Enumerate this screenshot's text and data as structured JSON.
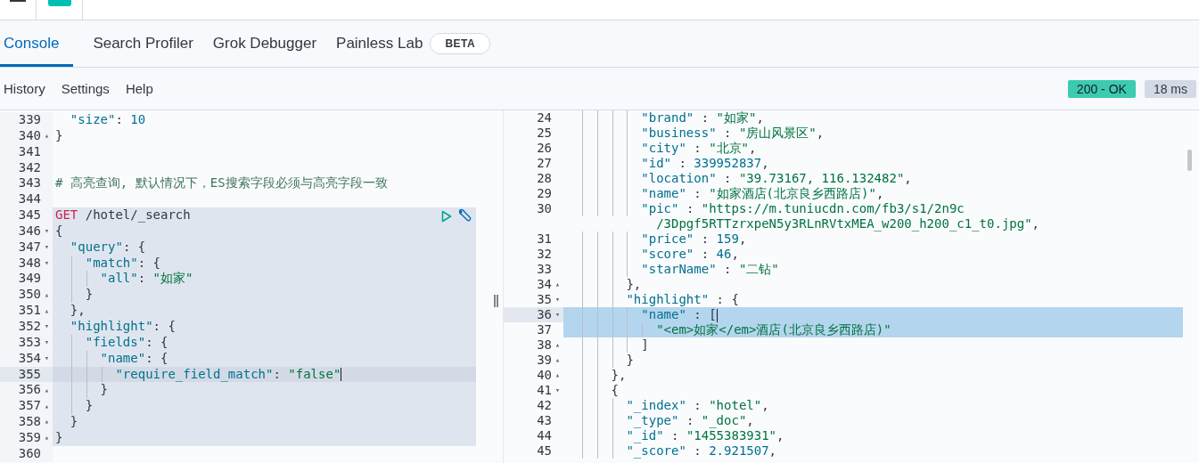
{
  "tabs": [
    {
      "label": "Console",
      "selected": true
    },
    {
      "label": "Search Profiler",
      "selected": false
    },
    {
      "label": "Grok Debugger",
      "selected": false
    },
    {
      "label": "Painless Lab",
      "selected": false,
      "badge": "BETA"
    }
  ],
  "menu": [
    "History",
    "Settings",
    "Help"
  ],
  "status": [
    {
      "text": "200 - OK",
      "kind": "success"
    },
    {
      "text": "18 ms",
      "kind": "neutral"
    }
  ],
  "request_editor": {
    "lines": [
      {
        "number": "339",
        "request": false,
        "active": false,
        "tokens": [
          {
            "kind": "key",
            "text": "  \"size\""
          },
          {
            "kind": "punct",
            "text": ": "
          },
          {
            "kind": "number",
            "text": "10"
          }
        ]
      },
      {
        "number": "340",
        "fold": "▴",
        "request": false,
        "active": false,
        "tokens": [
          {
            "kind": "punct",
            "text": "}"
          }
        ]
      },
      {
        "number": "341",
        "request": false,
        "active": false
      },
      {
        "number": "342",
        "request": false,
        "active": false
      },
      {
        "number": "343",
        "request": false,
        "active": false,
        "tokens": [
          {
            "kind": "comment",
            "text": "# 高亮查询, 默认情况下，ES搜索字段必须与高亮字段一致"
          }
        ]
      },
      {
        "number": "344",
        "request": false,
        "active": false
      },
      {
        "number": "345",
        "request": true,
        "active": false,
        "tokens": [
          {
            "kind": "method",
            "text": "GET"
          },
          {
            "kind": "path",
            "text": " /hotel/_search"
          }
        ]
      },
      {
        "number": "346",
        "fold": "▾",
        "request": true,
        "active": false,
        "tokens": [
          {
            "kind": "punct",
            "text": "{"
          }
        ]
      },
      {
        "number": "347",
        "fold": "▾",
        "request": true,
        "active": false,
        "tokens": [
          {
            "kind": "key",
            "text": "  \"query\""
          },
          {
            "kind": "punct",
            "text": ": {"
          }
        ]
      },
      {
        "number": "348",
        "fold": "▾",
        "request": true,
        "active": false,
        "tokens": [
          {
            "kind": "key",
            "text": "    \"match\""
          },
          {
            "kind": "punct",
            "text": ": {"
          }
        ]
      },
      {
        "number": "349",
        "request": true,
        "active": false,
        "tokens": [
          {
            "kind": "key",
            "text": "      \"all\""
          },
          {
            "kind": "punct",
            "text": ": "
          },
          {
            "kind": "string",
            "text": "\"如家\""
          }
        ]
      },
      {
        "number": "350",
        "fold": "▴",
        "request": true,
        "active": false,
        "tokens": [
          {
            "kind": "punct",
            "text": "    }"
          }
        ]
      },
      {
        "number": "351",
        "fold": "▴",
        "request": true,
        "active": false,
        "tokens": [
          {
            "kind": "punct",
            "text": "  },"
          }
        ]
      },
      {
        "number": "352",
        "fold": "▾",
        "request": true,
        "active": false,
        "tokens": [
          {
            "kind": "key",
            "text": "  \"highlight\""
          },
          {
            "kind": "punct",
            "text": ": {"
          }
        ]
      },
      {
        "number": "353",
        "fold": "▾",
        "request": true,
        "active": false,
        "tokens": [
          {
            "kind": "key",
            "text": "    \"fields\""
          },
          {
            "kind": "punct",
            "text": ": {"
          }
        ]
      },
      {
        "number": "354",
        "fold": "▾",
        "request": true,
        "active": false,
        "tokens": [
          {
            "kind": "key",
            "text": "      \"name\""
          },
          {
            "kind": "punct",
            "text": ": {"
          }
        ]
      },
      {
        "number": "355",
        "request": true,
        "active": true,
        "tokens": [
          {
            "kind": "key",
            "text": "        \"require_field_match\""
          },
          {
            "kind": "punct",
            "text": ": "
          },
          {
            "kind": "string",
            "text": "\"false\""
          }
        ]
      },
      {
        "number": "356",
        "fold": "▴",
        "request": true,
        "active": false,
        "tokens": [
          {
            "kind": "punct",
            "text": "      }"
          }
        ]
      },
      {
        "number": "357",
        "fold": "▴",
        "request": true,
        "active": false,
        "tokens": [
          {
            "kind": "punct",
            "text": "    }"
          }
        ]
      },
      {
        "number": "358",
        "fold": "▴",
        "request": true,
        "active": false,
        "tokens": [
          {
            "kind": "punct",
            "text": "  }"
          }
        ]
      },
      {
        "number": "359",
        "fold": "▴",
        "request": true,
        "active": false,
        "tokens": [
          {
            "kind": "punct",
            "text": "}"
          }
        ]
      },
      {
        "number": "360",
        "request": false,
        "active": false
      }
    ]
  },
  "response_viewer": {
    "lines": [
      {
        "number": "24",
        "active": false,
        "selected": false,
        "tokens": [
          {
            "kind": "key",
            "text": "          \"brand\""
          },
          {
            "kind": "punct",
            "text": " : "
          },
          {
            "kind": "string",
            "text": "\"如家\""
          },
          {
            "kind": "punct",
            "text": ","
          }
        ]
      },
      {
        "number": "25",
        "active": false,
        "selected": false,
        "tokens": [
          {
            "kind": "key",
            "text": "          \"business\""
          },
          {
            "kind": "punct",
            "text": " : "
          },
          {
            "kind": "string",
            "text": "\"房山风景区\""
          },
          {
            "kind": "punct",
            "text": ","
          }
        ]
      },
      {
        "number": "26",
        "active": false,
        "selected": false,
        "tokens": [
          {
            "kind": "key",
            "text": "          \"city\""
          },
          {
            "kind": "punct",
            "text": " : "
          },
          {
            "kind": "string",
            "text": "\"北京\""
          },
          {
            "kind": "punct",
            "text": ","
          }
        ]
      },
      {
        "number": "27",
        "active": false,
        "selected": false,
        "tokens": [
          {
            "kind": "key",
            "text": "          \"id\""
          },
          {
            "kind": "punct",
            "text": " : "
          },
          {
            "kind": "number",
            "text": "339952837"
          },
          {
            "kind": "punct",
            "text": ","
          }
        ]
      },
      {
        "number": "28",
        "active": false,
        "selected": false,
        "tokens": [
          {
            "kind": "key",
            "text": "          \"location\""
          },
          {
            "kind": "punct",
            "text": " : "
          },
          {
            "kind": "string",
            "text": "\"39.73167, 116.132482\""
          },
          {
            "kind": "punct",
            "text": ","
          }
        ]
      },
      {
        "number": "29",
        "active": false,
        "selected": false,
        "tokens": [
          {
            "kind": "key",
            "text": "          \"name\""
          },
          {
            "kind": "punct",
            "text": " : "
          },
          {
            "kind": "string",
            "text": "\"如家酒店(北京良乡西路店)\""
          },
          {
            "kind": "punct",
            "text": ","
          }
        ]
      },
      {
        "number": "30",
        "active": false,
        "selected": false,
        "tokens": [
          {
            "kind": "key",
            "text": "          \"pic\""
          },
          {
            "kind": "punct",
            "text": " : "
          },
          {
            "kind": "string",
            "text": "\"https://m.tuniucdn.com/fb3/s1/2n9c"
          }
        ]
      },
      {
        "active": false,
        "selected": false,
        "tokens": [
          {
            "kind": "string",
            "text": "            /3Dpgf5RTTzrxpeN5y3RLnRVtxMEA_w200_h200_c1_t0.jpg\""
          },
          {
            "kind": "punct",
            "text": ","
          }
        ]
      },
      {
        "number": "31",
        "active": false,
        "selected": false,
        "tokens": [
          {
            "kind": "key",
            "text": "          \"price\""
          },
          {
            "kind": "punct",
            "text": " : "
          },
          {
            "kind": "number",
            "text": "159"
          },
          {
            "kind": "punct",
            "text": ","
          }
        ]
      },
      {
        "number": "32",
        "active": false,
        "selected": false,
        "tokens": [
          {
            "kind": "key",
            "text": "          \"score\""
          },
          {
            "kind": "punct",
            "text": " : "
          },
          {
            "kind": "number",
            "text": "46"
          },
          {
            "kind": "punct",
            "text": ","
          }
        ]
      },
      {
        "number": "33",
        "active": false,
        "selected": false,
        "tokens": [
          {
            "kind": "key",
            "text": "          \"starName\""
          },
          {
            "kind": "punct",
            "text": " : "
          },
          {
            "kind": "string",
            "text": "\"二钻\""
          }
        ]
      },
      {
        "number": "34",
        "fold": "▴",
        "active": false,
        "selected": false,
        "tokens": [
          {
            "kind": "punct",
            "text": "        },"
          }
        ]
      },
      {
        "number": "35",
        "fold": "▾",
        "active": false,
        "selected": false,
        "tokens": [
          {
            "kind": "key",
            "text": "        \"highlight\""
          },
          {
            "kind": "punct",
            "text": " : {"
          }
        ]
      },
      {
        "number": "36",
        "fold": "▾",
        "active": true,
        "selected": true,
        "tokens": [
          {
            "kind": "key",
            "text": "          \"name\""
          },
          {
            "kind": "punct",
            "text": " : ["
          }
        ]
      },
      {
        "number": "37",
        "active": false,
        "selected": true,
        "tokens": [
          {
            "kind": "string",
            "text": "            \"<em>如家</em>酒店(北京良乡西路店)\""
          }
        ]
      },
      {
        "number": "38",
        "fold": "▴",
        "active": false,
        "selected": false,
        "tokens": [
          {
            "kind": "punct",
            "text": "          ]"
          }
        ]
      },
      {
        "number": "39",
        "fold": "▴",
        "active": false,
        "selected": false,
        "tokens": [
          {
            "kind": "punct",
            "text": "        }"
          }
        ]
      },
      {
        "number": "40",
        "fold": "▴",
        "active": false,
        "selected": false,
        "tokens": [
          {
            "kind": "punct",
            "text": "      },"
          }
        ]
      },
      {
        "number": "41",
        "fold": "▾",
        "active": false,
        "selected": false,
        "tokens": [
          {
            "kind": "punct",
            "text": "      {"
          }
        ]
      },
      {
        "number": "42",
        "active": false,
        "selected": false,
        "tokens": [
          {
            "kind": "key",
            "text": "        \"_index\""
          },
          {
            "kind": "punct",
            "text": " : "
          },
          {
            "kind": "string",
            "text": "\"hotel\""
          },
          {
            "kind": "punct",
            "text": ","
          }
        ]
      },
      {
        "number": "43",
        "active": false,
        "selected": false,
        "tokens": [
          {
            "kind": "key",
            "text": "        \"_type\""
          },
          {
            "kind": "punct",
            "text": " : "
          },
          {
            "kind": "string",
            "text": "\"_doc\""
          },
          {
            "kind": "punct",
            "text": ","
          }
        ]
      },
      {
        "number": "44",
        "active": false,
        "selected": false,
        "tokens": [
          {
            "kind": "key",
            "text": "        \"_id\""
          },
          {
            "kind": "punct",
            "text": " : "
          },
          {
            "kind": "string",
            "text": "\"1455383931\""
          },
          {
            "kind": "punct",
            "text": ","
          }
        ]
      },
      {
        "number": "45",
        "active": false,
        "selected": false,
        "tokens": [
          {
            "kind": "key",
            "text": "        \"_score\""
          },
          {
            "kind": "punct",
            "text": " : "
          },
          {
            "kind": "number",
            "text": "2.921507"
          },
          {
            "kind": "punct",
            "text": ","
          }
        ]
      }
    ]
  }
}
